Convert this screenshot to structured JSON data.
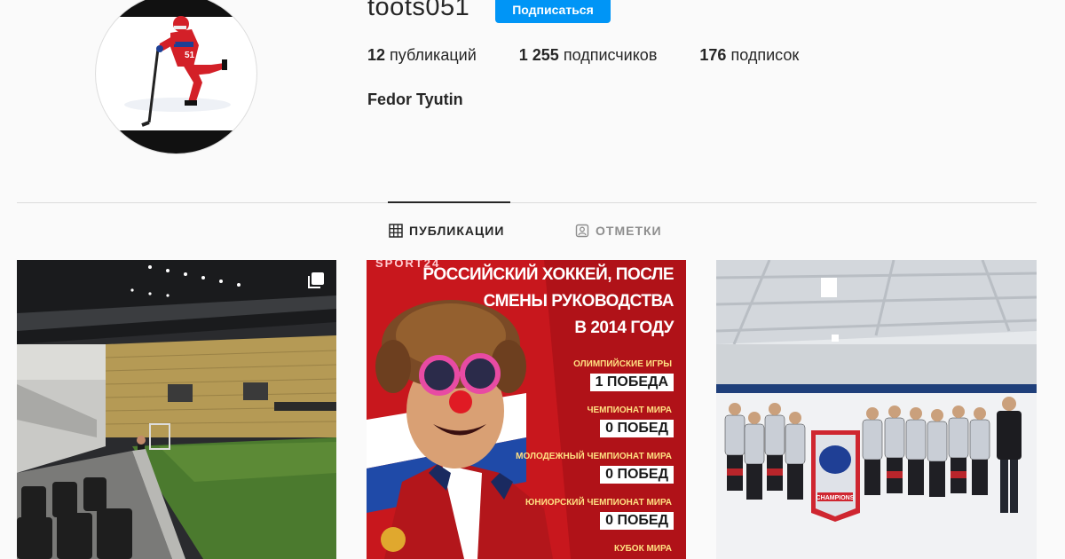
{
  "profile": {
    "username": "toots051",
    "follow_label": "Подписаться",
    "full_name": "Fedor Tyutin",
    "stats": {
      "posts_count": "12",
      "posts_label": "публикаций",
      "followers_count": "1 255",
      "followers_label": "подписчиков",
      "following_count": "176",
      "following_label": "подписок"
    }
  },
  "tabs": [
    {
      "label": "ПУБЛИКАЦИИ",
      "icon": "grid-icon",
      "active": true
    },
    {
      "label": "ОТМЕТКИ",
      "icon": "tagged-person-icon",
      "active": false
    }
  ],
  "posts": [
    {
      "subject": "stadium",
      "multi_image": true
    },
    {
      "subject": "poster",
      "brand": "SPORT24",
      "heading_line1": "РОССИЙСКИЙ ХОККЕЙ, ПОСЛЕ",
      "heading_line2": "СМЕНЫ РУКОВОДСТВА",
      "heading_line3": "В 2014 ГОДУ",
      "rows": [
        {
          "label": "ОЛИМПИЙСКИЕ ИГРЫ",
          "value": "1 ПОБЕДА"
        },
        {
          "label": "ЧЕМПИОНАТ МИРА",
          "value": "0 ПОБЕД"
        },
        {
          "label": "МОЛОДЕЖНЫЙ ЧЕМПИОНАТ МИРА",
          "value": "0 ПОБЕД"
        },
        {
          "label": "ЮНИОРСКИЙ ЧЕМПИОНАТ МИРА",
          "value": "0 ПОБЕД"
        },
        {
          "label": "КУБОК МИРА",
          "value": ""
        }
      ]
    },
    {
      "subject": "team-photo",
      "banner_text": "CHAMPIONS"
    }
  ],
  "colors": {
    "accent": "#0095f6",
    "poster_red": "#c8171d",
    "text": "#262626",
    "muted": "#8e8e8e"
  }
}
